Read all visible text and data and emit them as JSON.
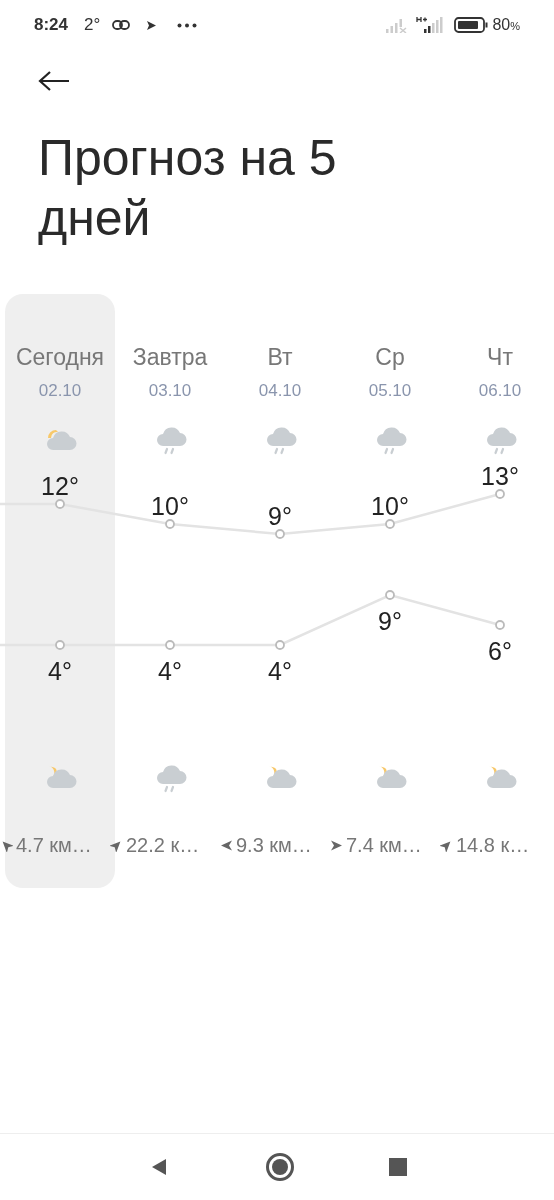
{
  "status_bar": {
    "time": "8:24",
    "temperature": "2°",
    "battery": "80",
    "battery_unit": "%"
  },
  "title": "Прогноз на 5 дней",
  "days": [
    {
      "name": "Сегодня",
      "date": "02.10",
      "selected": true,
      "day_icon": {
        "kind": "cloudy_sun"
      },
      "high": "12°",
      "low": "4°",
      "night_icon": {
        "kind": "cloudy_moon"
      },
      "wind_arrow": {
        "kind": "nw"
      },
      "wind": "4.7 км…"
    },
    {
      "name": "Завтра",
      "date": "03.10",
      "selected": false,
      "day_icon": {
        "kind": "rain"
      },
      "high": "10°",
      "low": "4°",
      "night_icon": {
        "kind": "rain"
      },
      "wind_arrow": {
        "kind": "ne"
      },
      "wind": "22.2 к…"
    },
    {
      "name": "Вт",
      "date": "04.10",
      "selected": false,
      "day_icon": {
        "kind": "rain"
      },
      "high": "9°",
      "low": "4°",
      "night_icon": {
        "kind": "cloudy_moon"
      },
      "wind_arrow": {
        "kind": "w"
      },
      "wind": "9.3 км…"
    },
    {
      "name": "Ср",
      "date": "05.10",
      "selected": false,
      "day_icon": {
        "kind": "rain"
      },
      "high": "10°",
      "low": "9°",
      "night_icon": {
        "kind": "cloudy_moon"
      },
      "wind_arrow": {
        "kind": "e"
      },
      "wind": "7.4 км…"
    },
    {
      "name": "Чт",
      "date": "06.10",
      "selected": false,
      "day_icon": {
        "kind": "rain"
      },
      "high": "13°",
      "low": "6°",
      "night_icon": {
        "kind": "cloudy_moon"
      },
      "wind_arrow": {
        "kind": "ne"
      },
      "wind": "14.8 к…"
    }
  ]
}
